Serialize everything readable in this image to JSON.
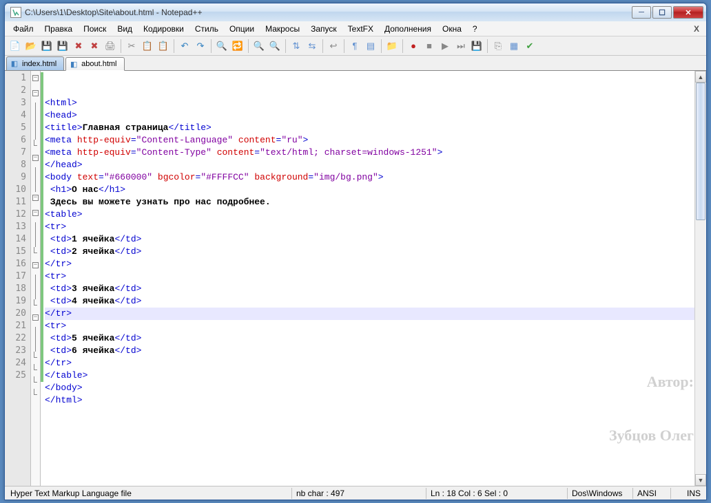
{
  "window": {
    "title": "C:\\Users\\1\\Desktop\\Site\\about.html - Notepad++"
  },
  "menu": [
    "Файл",
    "Правка",
    "Поиск",
    "Вид",
    "Кодировки",
    "Стиль",
    "Опции",
    "Макросы",
    "Запуск",
    "TextFX",
    "Дополнения",
    "Окна",
    "?"
  ],
  "tabs": [
    {
      "label": "index.html",
      "active": false
    },
    {
      "label": "about.html",
      "active": true
    }
  ],
  "lines": [
    {
      "n": 1,
      "fold": "-",
      "html": "<span class='t-tag'>&lt;html&gt;</span>"
    },
    {
      "n": 2,
      "fold": "-",
      "html": "<span class='t-tag'>&lt;head&gt;</span>"
    },
    {
      "n": 3,
      "fold": "",
      "html": "<span class='t-tag'>&lt;title&gt;</span><span class='t-txt'>Главная страница</span><span class='t-tag'>&lt;/title&gt;</span>"
    },
    {
      "n": 4,
      "fold": "",
      "html": "<span class='t-tag'>&lt;meta</span> <span class='t-attr'>http-equiv</span><span class='t-tag'>=</span><span class='t-str'>\"Content-Language\"</span> <span class='t-attr'>content</span><span class='t-tag'>=</span><span class='t-str'>\"ru\"</span><span class='t-tag'>&gt;</span>"
    },
    {
      "n": 5,
      "fold": "",
      "html": "<span class='t-tag'>&lt;meta</span> <span class='t-attr'>http-equiv</span><span class='t-tag'>=</span><span class='t-str'>\"Content-Type\"</span> <span class='t-attr'>content</span><span class='t-tag'>=</span><span class='t-str'>\"text/html; charset=windows-1251\"</span><span class='t-tag'>&gt;</span>"
    },
    {
      "n": 6,
      "fold": "e",
      "html": "<span class='t-tag'>&lt;/head&gt;</span>"
    },
    {
      "n": 7,
      "fold": "-",
      "html": "<span class='t-tag'>&lt;body</span> <span class='t-attr'>text</span><span class='t-tag'>=</span><span class='t-str'>\"#660000\"</span> <span class='t-attr'>bgcolor</span><span class='t-tag'>=</span><span class='t-str'>\"#FFFFCC\"</span> <span class='t-attr'>background</span><span class='t-tag'>=</span><span class='t-str'>\"img/bg.png\"</span><span class='t-tag'>&gt;</span>"
    },
    {
      "n": 8,
      "fold": "",
      "html": " <span class='t-tag'>&lt;h1&gt;</span><span class='t-txt'>О нас</span><span class='t-tag'>&lt;/h1&gt;</span>"
    },
    {
      "n": 9,
      "fold": "",
      "html": " <span class='t-txt'>Здесь вы можете узнать про нас подробнее.</span>"
    },
    {
      "n": 10,
      "fold": "-",
      "html": "<span class='t-tag'>&lt;table&gt;</span>"
    },
    {
      "n": 11,
      "fold": "-",
      "html": "<span class='t-tag'>&lt;tr&gt;</span>"
    },
    {
      "n": 12,
      "fold": "",
      "html": " <span class='t-tag'>&lt;td&gt;</span><span class='t-txt'>1 ячейка</span><span class='t-tag'>&lt;/td&gt;</span>"
    },
    {
      "n": 13,
      "fold": "",
      "html": " <span class='t-tag'>&lt;td&gt;</span><span class='t-txt'>2 ячейка</span><span class='t-tag'>&lt;/td&gt;</span>"
    },
    {
      "n": 14,
      "fold": "e",
      "html": "<span class='t-tag'>&lt;/tr&gt;</span>"
    },
    {
      "n": 15,
      "fold": "-",
      "html": "<span class='t-tag'>&lt;tr&gt;</span>"
    },
    {
      "n": 16,
      "fold": "",
      "html": " <span class='t-tag'>&lt;td&gt;</span><span class='t-txt'>3 ячейка</span><span class='t-tag'>&lt;/td&gt;</span>"
    },
    {
      "n": 17,
      "fold": "",
      "html": " <span class='t-tag'>&lt;td&gt;</span><span class='t-txt'>4 ячейка</span><span class='t-tag'>&lt;/td&gt;</span>"
    },
    {
      "n": 18,
      "fold": "e",
      "hl": true,
      "html": "<span class='t-tag'>&lt;/tr&gt;</span>"
    },
    {
      "n": 19,
      "fold": "-",
      "html": "<span class='t-tag'>&lt;tr&gt;</span>"
    },
    {
      "n": 20,
      "fold": "",
      "html": " <span class='t-tag'>&lt;td&gt;</span><span class='t-txt'>5 ячейка</span><span class='t-tag'>&lt;/td&gt;</span>"
    },
    {
      "n": 21,
      "fold": "",
      "html": " <span class='t-tag'>&lt;td&gt;</span><span class='t-txt'>6 ячейка</span><span class='t-tag'>&lt;/td&gt;</span>"
    },
    {
      "n": 22,
      "fold": "e",
      "html": "<span class='t-tag'>&lt;/tr&gt;</span>"
    },
    {
      "n": 23,
      "fold": "e",
      "html": "<span class='t-tag'>&lt;/table&gt;</span>"
    },
    {
      "n": 24,
      "fold": "e",
      "html": "<span class='t-tag'>&lt;/body&gt;</span>"
    },
    {
      "n": 25,
      "fold": "e",
      "html": "<span class='t-tag'>&lt;/html&gt;</span>"
    }
  ],
  "status": {
    "lang": "Hyper Text Markup Language file",
    "chars": "nb char : 497",
    "pos": "Ln : 18   Col : 6   Sel : 0",
    "eol": "Dos\\Windows",
    "enc": "ANSI",
    "ins": "INS"
  },
  "watermark": {
    "l1": "Автор:",
    "l2": "Зубцов Олег"
  },
  "toolbar_icons": [
    {
      "n": "new-file-icon",
      "c": "#f8f8d0",
      "g": "📄"
    },
    {
      "n": "open-file-icon",
      "c": "#f0c060",
      "g": "📂"
    },
    {
      "n": "save-icon",
      "c": "#4060a0",
      "g": "💾"
    },
    {
      "n": "save-all-icon",
      "c": "#4060a0",
      "g": "💾"
    },
    {
      "n": "close-icon",
      "c": "#c04040",
      "g": "✖"
    },
    {
      "n": "close-all-icon",
      "c": "#c04040",
      "g": "✖"
    },
    {
      "n": "print-icon",
      "c": "#888",
      "g": "🖨"
    },
    {
      "n": "sep"
    },
    {
      "n": "cut-icon",
      "c": "#888",
      "g": "✂"
    },
    {
      "n": "copy-icon",
      "c": "#6090d0",
      "g": "📋"
    },
    {
      "n": "paste-icon",
      "c": "#6090d0",
      "g": "📋"
    },
    {
      "n": "sep"
    },
    {
      "n": "undo-icon",
      "c": "#3080c0",
      "g": "↶"
    },
    {
      "n": "redo-icon",
      "c": "#3080c0",
      "g": "↷"
    },
    {
      "n": "sep"
    },
    {
      "n": "find-icon",
      "c": "#888",
      "g": "🔍"
    },
    {
      "n": "replace-icon",
      "c": "#888",
      "g": "🔁"
    },
    {
      "n": "sep"
    },
    {
      "n": "zoom-in-icon",
      "c": "#888",
      "g": "🔍"
    },
    {
      "n": "zoom-out-icon",
      "c": "#888",
      "g": "🔍"
    },
    {
      "n": "sep"
    },
    {
      "n": "sync-v-icon",
      "c": "#6090d0",
      "g": "⇅"
    },
    {
      "n": "sync-h-icon",
      "c": "#6090d0",
      "g": "⇆"
    },
    {
      "n": "sep"
    },
    {
      "n": "wordwrap-icon",
      "c": "#888",
      "g": "↩"
    },
    {
      "n": "sep"
    },
    {
      "n": "show-all-icon",
      "c": "#6090d0",
      "g": "¶"
    },
    {
      "n": "indent-guide-icon",
      "c": "#6090d0",
      "g": "▤"
    },
    {
      "n": "sep"
    },
    {
      "n": "folder-as-workspace-icon",
      "c": "#f0c060",
      "g": "📁"
    },
    {
      "n": "sep"
    },
    {
      "n": "macro-record-icon",
      "c": "#c02020",
      "g": "●"
    },
    {
      "n": "macro-stop-icon",
      "c": "#888",
      "g": "■"
    },
    {
      "n": "macro-play-icon",
      "c": "#888",
      "g": "▶"
    },
    {
      "n": "macro-play-multi-icon",
      "c": "#888",
      "g": "⏭"
    },
    {
      "n": "macro-save-icon",
      "c": "#4060a0",
      "g": "💾"
    },
    {
      "n": "sep"
    },
    {
      "n": "compare-icon",
      "c": "#888",
      "g": "⎘"
    },
    {
      "n": "doc-map-icon",
      "c": "#6090d0",
      "g": "▦"
    },
    {
      "n": "spellcheck-icon",
      "c": "#40a040",
      "g": "✔"
    }
  ]
}
